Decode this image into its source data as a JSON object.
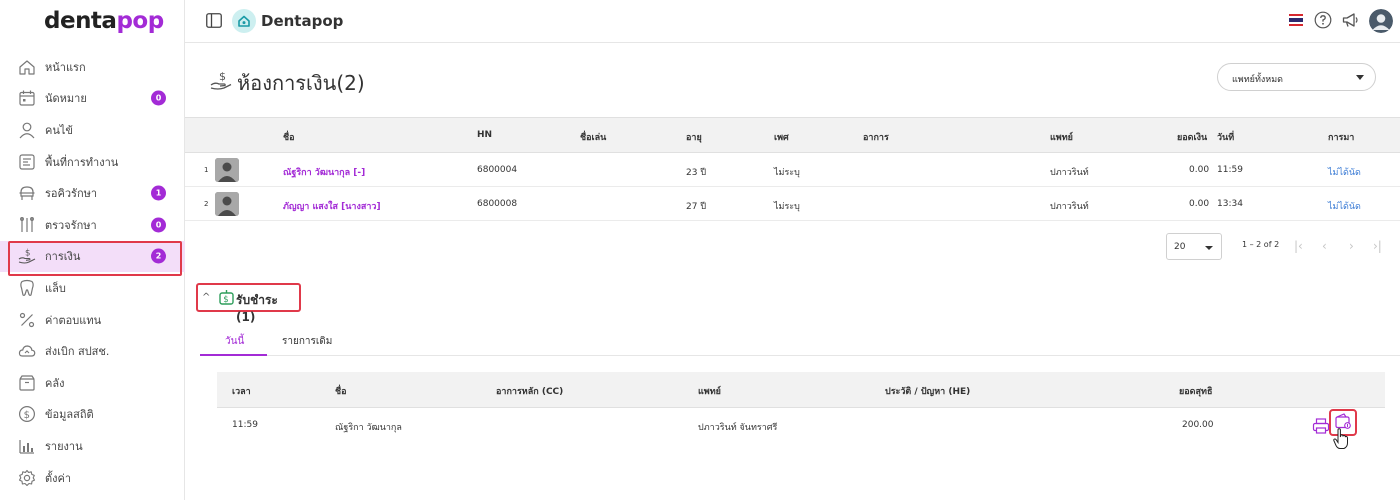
{
  "sidebar": {
    "logo_main": "denta",
    "logo_accent": "pop",
    "items": [
      {
        "label": "หน้าแรก",
        "icon": "home-icon",
        "badge": ""
      },
      {
        "label": "นัดหมาย",
        "icon": "calendar-icon",
        "badge": "0"
      },
      {
        "label": "คนไข้",
        "icon": "user-icon",
        "badge": ""
      },
      {
        "label": "พื้นที่การทำงาน",
        "icon": "workspace-icon",
        "badge": ""
      },
      {
        "label": "รอคิวรักษา",
        "icon": "waiting-chair-icon",
        "badge": "1"
      },
      {
        "label": "ตรวจรักษา",
        "icon": "dental-tools-icon",
        "badge": "0"
      },
      {
        "label": "การเงิน",
        "icon": "hand-money-icon",
        "badge": "2",
        "active": true
      },
      {
        "label": "แล็บ",
        "icon": "tooth-icon",
        "badge": ""
      },
      {
        "label": "ค่าตอบแทน",
        "icon": "percent-icon",
        "badge": ""
      },
      {
        "label": "ส่งเบิก สปสช.",
        "icon": "cloud-upload-icon",
        "badge": ""
      },
      {
        "label": "คลัง",
        "icon": "box-icon",
        "badge": ""
      },
      {
        "label": "ข้อมูลสถิติ",
        "icon": "dollar-circle-icon",
        "badge": ""
      },
      {
        "label": "รายงาน",
        "icon": "bar-chart-icon",
        "badge": ""
      },
      {
        "label": "ตั้งค่า",
        "icon": "gear-icon",
        "badge": ""
      }
    ]
  },
  "header": {
    "title": "Dentapop"
  },
  "page": {
    "title": "ห้องการเงิน(2)",
    "doctor_filter": "แพทย์ทั้งหมด"
  },
  "queue": {
    "columns": [
      "ชื่อ",
      "HN",
      "ชื่อเล่น",
      "อายุ",
      "เพศ",
      "อาการ",
      "แพทย์",
      "ยอดเงิน",
      "วันที่",
      "การมา"
    ],
    "rows": [
      {
        "num": "1",
        "name": "ณัฐริกา วัฒนากุล [-]",
        "hn": "6800004",
        "nickname": "",
        "age": "23 ปี",
        "sex": "ไม่ระบุ",
        "symptom": "",
        "doctor": "ปภาวรินท์",
        "amount": "0.00",
        "time": "11:59",
        "visit": "ไม่ได้นัด"
      },
      {
        "num": "2",
        "name": "ภัญญา แสงใส [นางสาว]",
        "hn": "6800008",
        "nickname": "",
        "age": "27 ปี",
        "sex": "ไม่ระบุ",
        "symptom": "",
        "doctor": "ปภาวรินท์",
        "amount": "0.00",
        "time": "13:34",
        "visit": "ไม่ได้นัด"
      }
    ],
    "page_size": "20",
    "range": "1 – 2 of 2"
  },
  "payment": {
    "section_label": "รับชำระ (1)",
    "tabs": [
      "วันนี้",
      "รายการเดิม"
    ],
    "columns": [
      "เวลา",
      "ชื่อ",
      "อาการหลัก (CC)",
      "แพทย์",
      "ประวัติ / ปัญหา (HE)",
      "ยอดสุทธิ"
    ],
    "rows": [
      {
        "time": "11:59",
        "name": "ณัฐริกา วัฒนากุล",
        "cc": "",
        "doctor": "ปภาวรินท์ จันทราศรี",
        "he": "",
        "net": "200.00"
      }
    ]
  },
  "colors": {
    "brand": "#a32bd6",
    "highlight": "#e0394a",
    "link": "#3a7bd5"
  }
}
